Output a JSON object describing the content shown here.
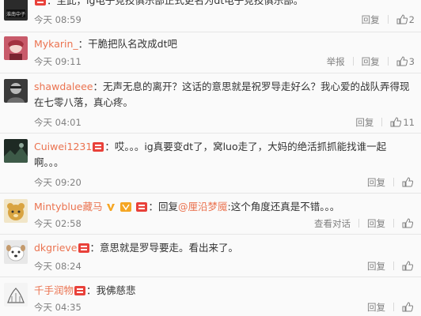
{
  "comments": [
    {
      "user": "",
      "text": "：至此，ig电子竞技俱乐部正式更名为dt电子竞技俱乐部。",
      "time": "今天 08:59",
      "reply": "回复",
      "likes": "2"
    },
    {
      "user": "Mykarin_",
      "text": "：干脆把队名改成dt吧",
      "time": "今天 09:11",
      "report": "举报",
      "reply": "回复",
      "likes": "3"
    },
    {
      "user": "shawdaleee",
      "text": "：无声无息的离开？这话的意思就是祝罗导走好么？我心爱的战队弄得现在七零八落，真心疼。",
      "time": "今天 04:01",
      "reply": "回复",
      "likes": "11"
    },
    {
      "user": "Cuiwei1231",
      "text": "：哎。。。ig真要变dt了，窝luo走了，大妈的绝活抓抓能找谁一起啊。。。",
      "time": "今天 09:20",
      "reply": "回复",
      "likes": ""
    },
    {
      "user": "Mintyblue藏马",
      "text_prefix": "：回复",
      "mention": "@厘沿梦魇",
      "text_suffix": ":这个角度还真是不错。。。",
      "time": "今天 02:58",
      "view_dialog": "查看对话",
      "reply": "回复",
      "likes": ""
    },
    {
      "user": "dkgrieve",
      "text": "：意思就是罗导要走。看出来了。",
      "time": "今天 08:24",
      "reply": "回复",
      "likes": ""
    },
    {
      "user": "千手润物",
      "text": "：我佛慈悲",
      "time": "今天 04:35",
      "reply": "回复",
      "likes": ""
    }
  ],
  "icons": {
    "like": "thumbs-up-icon",
    "member_badge": "red-member-badge-icon",
    "verified": "yellow-v-icon"
  },
  "colors": {
    "username": "#eb7350",
    "meta_text": "#808080",
    "badge_red": "#e9413a",
    "verified_gold": "#f5a623",
    "divider": "#e6e6e6"
  }
}
